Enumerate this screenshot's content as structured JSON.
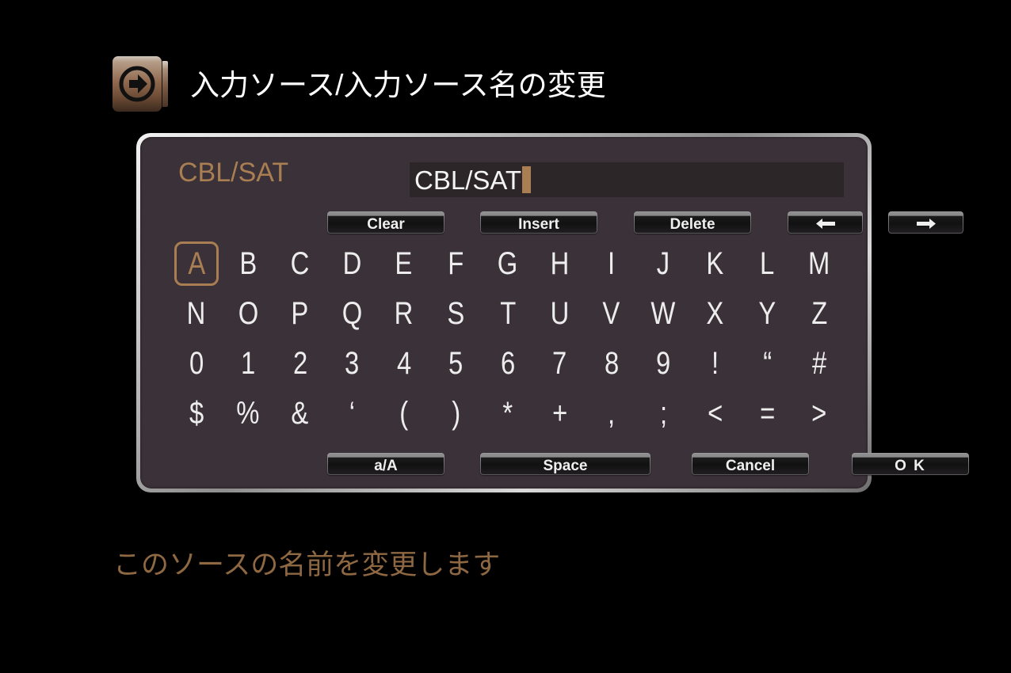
{
  "header": {
    "title": "入力ソース/入力ソース名の変更",
    "icon": "input-source-arrow-icon"
  },
  "dialog": {
    "source_label": "CBL/SAT",
    "name_input": {
      "value": "CBL/SAT",
      "placeholder": "",
      "caret": "|"
    },
    "edit_buttons": [
      {
        "label": "Clear",
        "name": "clear-button"
      },
      {
        "label": "Insert",
        "name": "insert-button"
      },
      {
        "label": "Delete",
        "name": "delete-button"
      },
      {
        "label": "←",
        "name": "cursor-left-button",
        "icon": "arrow-left-icon"
      },
      {
        "label": "→",
        "name": "cursor-right-button",
        "icon": "arrow-right-icon"
      }
    ],
    "keyboard": {
      "selected": "A",
      "rows": [
        [
          "A",
          "B",
          "C",
          "D",
          "E",
          "F",
          "G",
          "H",
          "I",
          "J",
          "K",
          "L",
          "M"
        ],
        [
          "N",
          "O",
          "P",
          "Q",
          "R",
          "S",
          "T",
          "U",
          "V",
          "W",
          "X",
          "Y",
          "Z"
        ],
        [
          "0",
          "1",
          "2",
          "3",
          "4",
          "5",
          "6",
          "7",
          "8",
          "9",
          "!",
          "“",
          "#"
        ],
        [
          "$",
          "%",
          "&",
          "‘",
          "(",
          ")",
          "*",
          "+",
          ",",
          ";",
          "<",
          "=",
          ">"
        ]
      ]
    },
    "action_buttons": [
      {
        "label": "a/A",
        "name": "case-toggle-button"
      },
      {
        "label": "Space",
        "name": "space-button"
      },
      {
        "label": "Cancel",
        "name": "cancel-button"
      },
      {
        "label": "O K",
        "name": "ok-button"
      }
    ]
  },
  "caption": "このソースの名前を変更します",
  "colors": {
    "background": "#000000",
    "panel_fill": "#3b3138",
    "panel_border": "#c8c8c8",
    "accent_brown": "#a87e52",
    "caption_brown": "#8e6842",
    "text_white": "#ededed",
    "input_fill": "#2c2629"
  }
}
